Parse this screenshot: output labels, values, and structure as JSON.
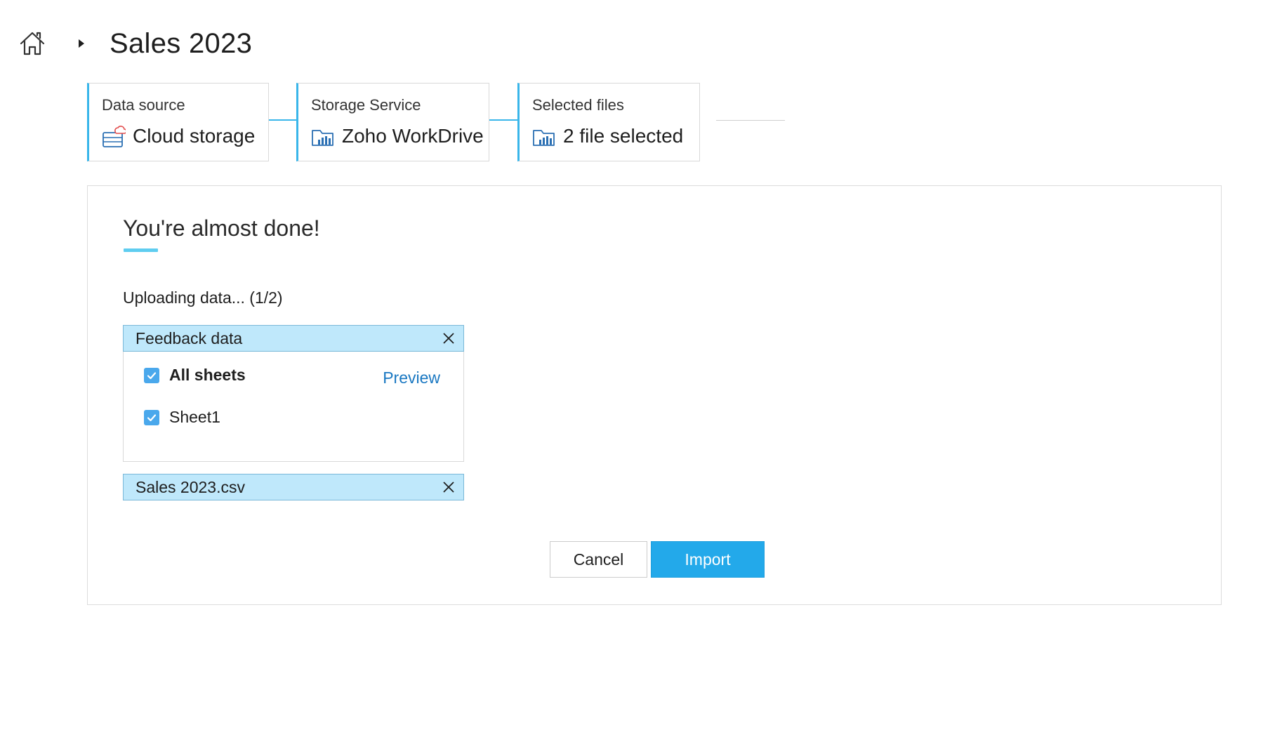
{
  "header": {
    "title": "Sales 2023",
    "home_icon": "home-icon",
    "separator_icon": "caret-right-icon"
  },
  "stepper": {
    "accent_color": "#39b6ea",
    "steps": [
      {
        "label": "Data source",
        "value": "Cloud storage",
        "icon": "cloud-storage-icon"
      },
      {
        "label": "Storage Service",
        "value": "Zoho WorkDrive",
        "icon": "workdrive-folder-icon"
      },
      {
        "label": "Selected files",
        "value": "2 file selected",
        "icon": "workdrive-folder-icon"
      }
    ]
  },
  "main": {
    "heading": "You're almost done!",
    "status": "Uploading data... (1/2)",
    "files": [
      {
        "name": "Feedback data",
        "expanded": true,
        "sheets": [
          {
            "label": "All sheets",
            "checked": true,
            "bold": true
          },
          {
            "label": "Sheet1",
            "checked": true,
            "bold": false
          }
        ],
        "preview_label": "Preview"
      },
      {
        "name": "Sales 2023.csv",
        "expanded": false
      }
    ],
    "buttons": {
      "cancel": "Cancel",
      "import": "Import"
    },
    "colors": {
      "file_header_bg": "#bfe8fb",
      "checkbox": "#4aa8ec",
      "link": "#1a78c2",
      "primary_button": "#23a9ea"
    }
  }
}
